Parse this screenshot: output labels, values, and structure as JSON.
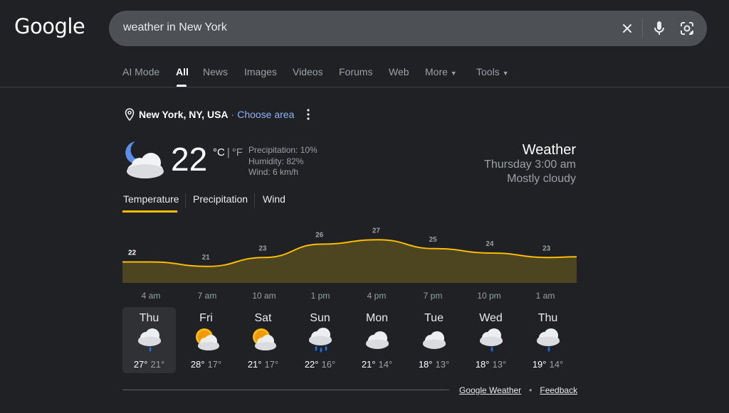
{
  "logo": "Google",
  "search": {
    "query": "weather in New York"
  },
  "nav": {
    "tabs": [
      {
        "label": "AI Mode",
        "active": false
      },
      {
        "label": "All",
        "active": true
      },
      {
        "label": "News",
        "active": false
      },
      {
        "label": "Images",
        "active": false
      },
      {
        "label": "Videos",
        "active": false
      },
      {
        "label": "Forums",
        "active": false
      },
      {
        "label": "Web",
        "active": false
      },
      {
        "label": "More",
        "active": false,
        "dropdown": true
      },
      {
        "label": "Tools",
        "active": false,
        "dropdown": true
      }
    ]
  },
  "location": {
    "name": "New York, NY, USA",
    "separator": "·",
    "choose_area": "Choose area"
  },
  "current": {
    "temp": "22",
    "unit_c": "°C",
    "unit_sep": "|",
    "unit_f": "°F",
    "precipitation": "Precipitation: 10%",
    "humidity": "Humidity: 82%",
    "wind": "Wind: 6 km/h",
    "icon": "moon-cloud-icon"
  },
  "summary": {
    "title": "Weather",
    "time": "Thursday 3:00 am",
    "condition": "Mostly cloudy"
  },
  "chart_tabs": [
    {
      "label": "Temperature",
      "active": true
    },
    {
      "label": "Precipitation",
      "active": false
    },
    {
      "label": "Wind",
      "active": false
    }
  ],
  "chart_data": {
    "type": "area",
    "x": [
      "4 am",
      "7 am",
      "10 am",
      "1 pm",
      "4 pm",
      "7 pm",
      "10 pm",
      "1 am"
    ],
    "values": [
      22,
      21,
      23,
      26,
      27,
      25,
      24,
      23
    ],
    "labels": [
      "22",
      "21",
      "23",
      "26",
      "27",
      "25",
      "24",
      "23"
    ],
    "line_color": "#fbbc04",
    "fill_color": "#4d4420"
  },
  "forecast": [
    {
      "day": "Thu",
      "high": "27°",
      "low": "21°",
      "icon": "cloud-rain-icon",
      "active": true
    },
    {
      "day": "Fri",
      "high": "28°",
      "low": "17°",
      "icon": "sun-cloud-icon",
      "active": false
    },
    {
      "day": "Sat",
      "high": "21°",
      "low": "17°",
      "icon": "sun-cloud-icon",
      "active": false
    },
    {
      "day": "Sun",
      "high": "22°",
      "low": "16°",
      "icon": "cloud-heavy-rain-icon",
      "active": false
    },
    {
      "day": "Mon",
      "high": "21°",
      "low": "14°",
      "icon": "cloud-icon",
      "active": false
    },
    {
      "day": "Tue",
      "high": "18°",
      "low": "13°",
      "icon": "cloud-icon",
      "active": false
    },
    {
      "day": "Wed",
      "high": "18°",
      "low": "13°",
      "icon": "cloud-rain-icon",
      "active": false
    },
    {
      "day": "Thu",
      "high": "19°",
      "low": "14°",
      "icon": "cloud-rain-icon",
      "active": false
    }
  ],
  "footer": {
    "source": "Google Weather",
    "bullet": "•",
    "feedback": "Feedback"
  }
}
